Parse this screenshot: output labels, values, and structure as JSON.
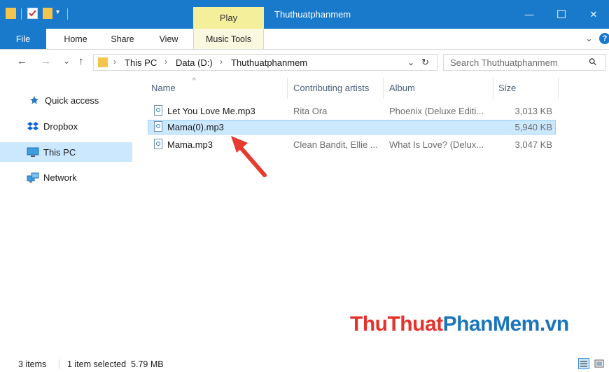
{
  "titlebar": {
    "contextual_tab": "Play",
    "window_title": "Thuthuatphanmem",
    "minimize_glyph": "—",
    "maximize_glyph": "☐",
    "close_glyph": "✕"
  },
  "ribbon": {
    "tabs": [
      "File",
      "Home",
      "Share",
      "View",
      "Music Tools"
    ],
    "collapse_glyph": "⌄",
    "help_glyph": "?"
  },
  "address": {
    "back_glyph": "←",
    "forward_glyph": "→",
    "recent_glyph": "⌄",
    "up_glyph": "↑",
    "crumbs": [
      "This PC",
      "Data (D:)",
      "Thuthuatphanmem"
    ],
    "crumb_sep": "›",
    "dropdown_glyph": "⌄",
    "refresh_glyph": "↻",
    "search_placeholder": "Search Thuthuatphanmem",
    "search_glyph": "⚲"
  },
  "nav": {
    "items": [
      "Quick access",
      "Dropbox",
      "This PC",
      "Network"
    ]
  },
  "columns": {
    "name": "Name",
    "artists": "Contributing artists",
    "album": "Album",
    "size": "Size",
    "sort_glyph": "^"
  },
  "files": [
    {
      "name": "Let You Love Me.mp3",
      "artists": "Rita Ora",
      "album": "Phoenix (Deluxe Editi...",
      "size": "3,013 KB"
    },
    {
      "name": "Mama(0).mp3",
      "artists": "",
      "album": "",
      "size": "5,940 KB"
    },
    {
      "name": "Mama.mp3",
      "artists": "Clean Bandit, Ellie ...",
      "album": "What Is Love? (Delux...",
      "size": "3,047 KB"
    }
  ],
  "status": {
    "count": "3 items",
    "selection": "1 item selected  5.79 MB"
  },
  "watermark": {
    "part1": "ThuThuat",
    "part2": "PhanMem",
    "part3": ".vn"
  },
  "colors": {
    "accent": "#1979ca",
    "selection": "#cce8ff",
    "arrow": "#e63b2e",
    "watermark_red": "#e5322b",
    "watermark_blue": "#1b75bb"
  }
}
